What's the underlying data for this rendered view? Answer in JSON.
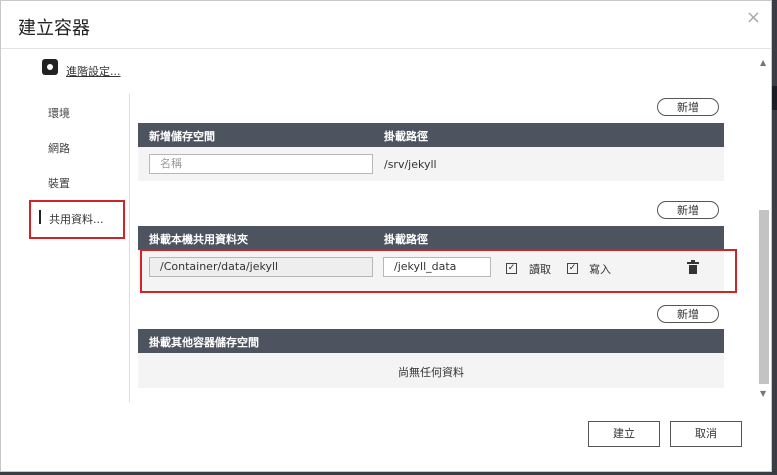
{
  "dialog": {
    "title": "建立容器",
    "close": "×"
  },
  "advanced": {
    "label": "進階設定..."
  },
  "sidebar": {
    "items": [
      {
        "label": "環境"
      },
      {
        "label": "網路"
      },
      {
        "label": "裝置"
      },
      {
        "label": "共用資料..."
      }
    ]
  },
  "section1": {
    "add_label": "新增",
    "col1": "新增儲存空間",
    "col2": "掛載路徑",
    "name_placeholder": "名稱",
    "path": "/srv/jekyll"
  },
  "section2": {
    "add_label": "新增",
    "col1": "掛載本機共用資料夾",
    "col2": "掛載路徑",
    "host_path": "/Container/data/jekyll",
    "mount_path": "/jekyll_data",
    "read_label": "讀取",
    "write_label": "寫入",
    "read_checked": true,
    "write_checked": true
  },
  "section3": {
    "add_label": "新增",
    "col1": "掛載其他容器儲存空間",
    "empty_text": "尚無任何資料"
  },
  "footer": {
    "create_label": "建立",
    "cancel_label": "取消"
  },
  "colors": {
    "header_bg": "#4d535f",
    "highlight": "#d0242b"
  }
}
